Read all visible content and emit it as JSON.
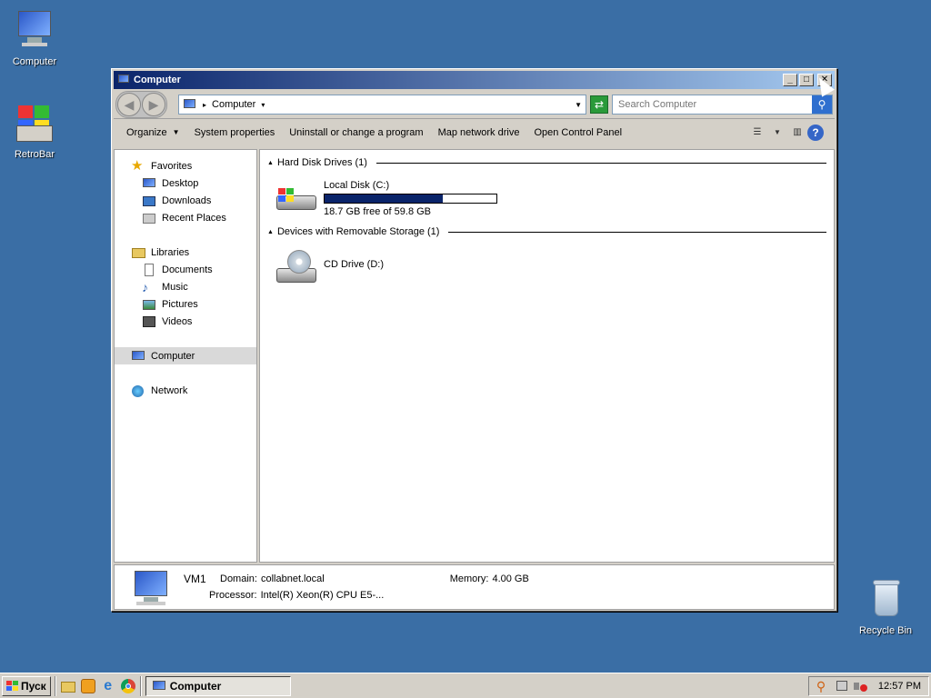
{
  "desktop": {
    "icons": [
      {
        "label": "Computer"
      },
      {
        "label": "RetroBar"
      },
      {
        "label": "Recycle Bin"
      }
    ]
  },
  "window": {
    "title": "Computer",
    "address": {
      "path": "Computer"
    },
    "search": {
      "placeholder": "Search Computer"
    },
    "commands": {
      "organize": "Organize",
      "system_properties": "System properties",
      "uninstall": "Uninstall or change a program",
      "map_drive": "Map network drive",
      "control_panel": "Open Control Panel"
    },
    "nav": {
      "favorites": "Favorites",
      "desktop": "Desktop",
      "downloads": "Downloads",
      "recent": "Recent Places",
      "libraries": "Libraries",
      "documents": "Documents",
      "music": "Music",
      "pictures": "Pictures",
      "videos": "Videos",
      "computer": "Computer",
      "network": "Network"
    },
    "groups": {
      "hdd_title": "Hard Disk Drives (1)",
      "removable_title": "Devices with Removable Storage (1)"
    },
    "drives": {
      "c_name": "Local Disk (C:)",
      "c_free": "18.7 GB free of 59.8 GB",
      "c_used_fraction": 0.687,
      "d_name": "CD Drive (D:)"
    },
    "details": {
      "name": "VM1",
      "domain_label": "Domain:",
      "domain_value": "collabnet.local",
      "memory_label": "Memory:",
      "memory_value": "4.00 GB",
      "processor_label": "Processor:",
      "processor_value": "Intel(R) Xeon(R) CPU E5-..."
    }
  },
  "taskbar": {
    "start_label": "Пуск",
    "task_label": "Computer",
    "clock": "12:57 PM"
  },
  "colors": {
    "desktop": "#3a6ea5",
    "title_start": "#0a246a",
    "title_end": "#a6caf0",
    "bar_fill": "#0a246a"
  }
}
